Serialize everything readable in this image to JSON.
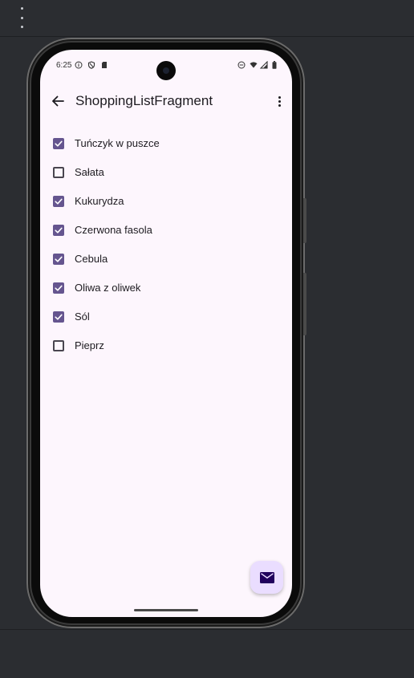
{
  "toolbar": {
    "menu_icon": "more-vert-icon"
  },
  "status_bar": {
    "time": "6:25",
    "left_icons": [
      "info-icon",
      "shield-icon",
      "sd-card-icon"
    ],
    "right_icons": [
      "dnd-icon",
      "wifi-icon",
      "signal-icon",
      "battery-icon"
    ]
  },
  "app_bar": {
    "title": "ShoppingListFragment",
    "back_icon": "arrow-back-icon",
    "overflow_icon": "more-vert-icon"
  },
  "shopping_list": {
    "items": [
      {
        "label": "Tuńczyk w puszce",
        "checked": true
      },
      {
        "label": "Sałata",
        "checked": false
      },
      {
        "label": "Kukurydza",
        "checked": true
      },
      {
        "label": "Czerwona fasola",
        "checked": true
      },
      {
        "label": "Cebula",
        "checked": true
      },
      {
        "label": "Oliwa z oliwek",
        "checked": true
      },
      {
        "label": "Sól",
        "checked": true
      },
      {
        "label": "Pieprz",
        "checked": false
      }
    ]
  },
  "fab": {
    "icon": "mail-icon"
  },
  "colors": {
    "accent": "#65558f",
    "screen_background": "#fdf6fd",
    "fab_background": "#eaddff",
    "ide_background": "#2b2d31"
  }
}
